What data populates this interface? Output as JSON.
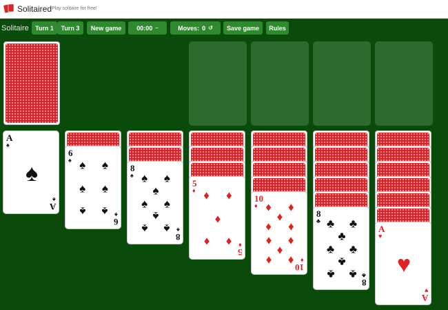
{
  "header": {
    "site_title": "Solitaired",
    "tagline": "Play solitaire for free!",
    "logo_icon": "playing-cards-logo"
  },
  "toolbar": {
    "title": "Solitaire",
    "turn1": "Turn 1",
    "turn3": "Turn 3",
    "new_game": "New game",
    "timer": "00:00",
    "timer_icon": "–",
    "moves_label": "Moves:",
    "moves_value": "0",
    "undo_icon": "↺",
    "save_game": "Save game",
    "rules": "Rules"
  },
  "colors": {
    "felt": "#0a4a0a",
    "button": "#2f8a2f",
    "slot": "#2d6a2d",
    "card_back": "#d7262b",
    "red_suit": "#e2201f"
  },
  "stock": {
    "face_down_cards": 1
  },
  "foundations": {
    "count": 4
  },
  "tableau": [
    {
      "face_down": 0,
      "top": {
        "rank": "A",
        "suit": "♠",
        "color": "black"
      }
    },
    {
      "face_down": 1,
      "top": {
        "rank": "6",
        "suit": "♠",
        "color": "black"
      }
    },
    {
      "face_down": 2,
      "top": {
        "rank": "8",
        "suit": "♠",
        "color": "black"
      }
    },
    {
      "face_down": 3,
      "top": {
        "rank": "5",
        "suit": "♦",
        "color": "red"
      }
    },
    {
      "face_down": 4,
      "top": {
        "rank": "10",
        "suit": "♦",
        "color": "red"
      }
    },
    {
      "face_down": 5,
      "top": {
        "rank": "8",
        "suit": "♣",
        "color": "black"
      }
    },
    {
      "face_down": 6,
      "top": {
        "rank": "A",
        "suit": "♥",
        "color": "red"
      }
    }
  ]
}
